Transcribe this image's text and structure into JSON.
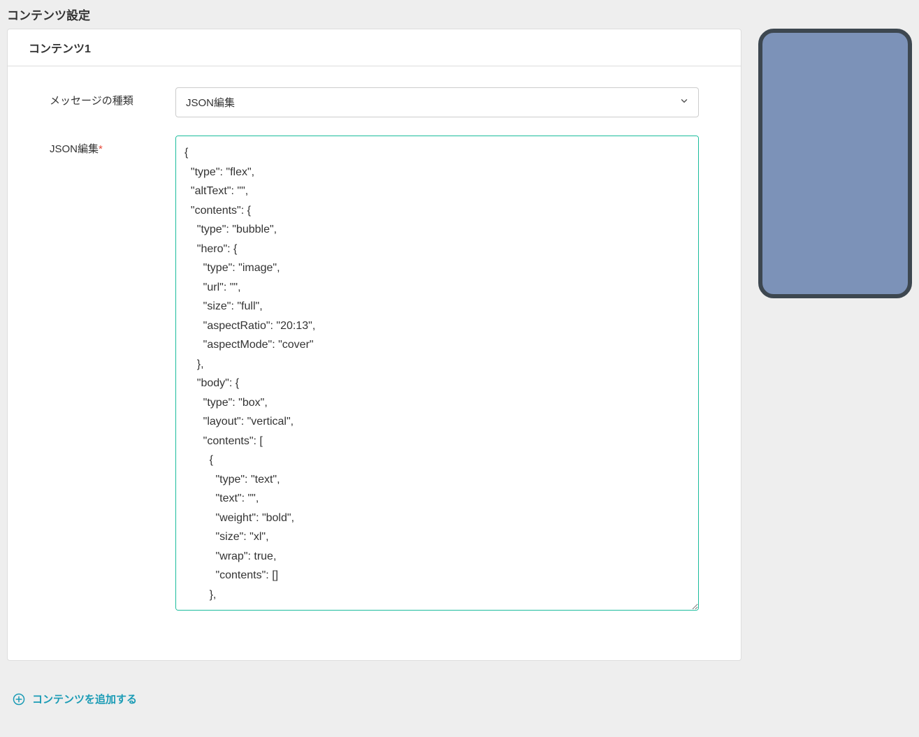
{
  "page": {
    "title": "コンテンツ設定"
  },
  "card": {
    "title": "コンテンツ1"
  },
  "form": {
    "message_type_label": "メッセージの種類",
    "message_type_value": "JSON編集",
    "json_edit_label": "JSON編集",
    "json_value": "{\n  \"type\": \"flex\",\n  \"altText\": \"\",\n  \"contents\": {\n    \"type\": \"bubble\",\n    \"hero\": {\n      \"type\": \"image\",\n      \"url\": \"\",\n      \"size\": \"full\",\n      \"aspectRatio\": \"20:13\",\n      \"aspectMode\": \"cover\"\n    },\n    \"body\": {\n      \"type\": \"box\",\n      \"layout\": \"vertical\",\n      \"contents\": [\n        {\n          \"type\": \"text\",\n          \"text\": \"\",\n          \"weight\": \"bold\",\n          \"size\": \"xl\",\n          \"wrap\": true,\n          \"contents\": []\n        },"
  },
  "actions": {
    "add_content_label": "コンテンツを追加する"
  }
}
